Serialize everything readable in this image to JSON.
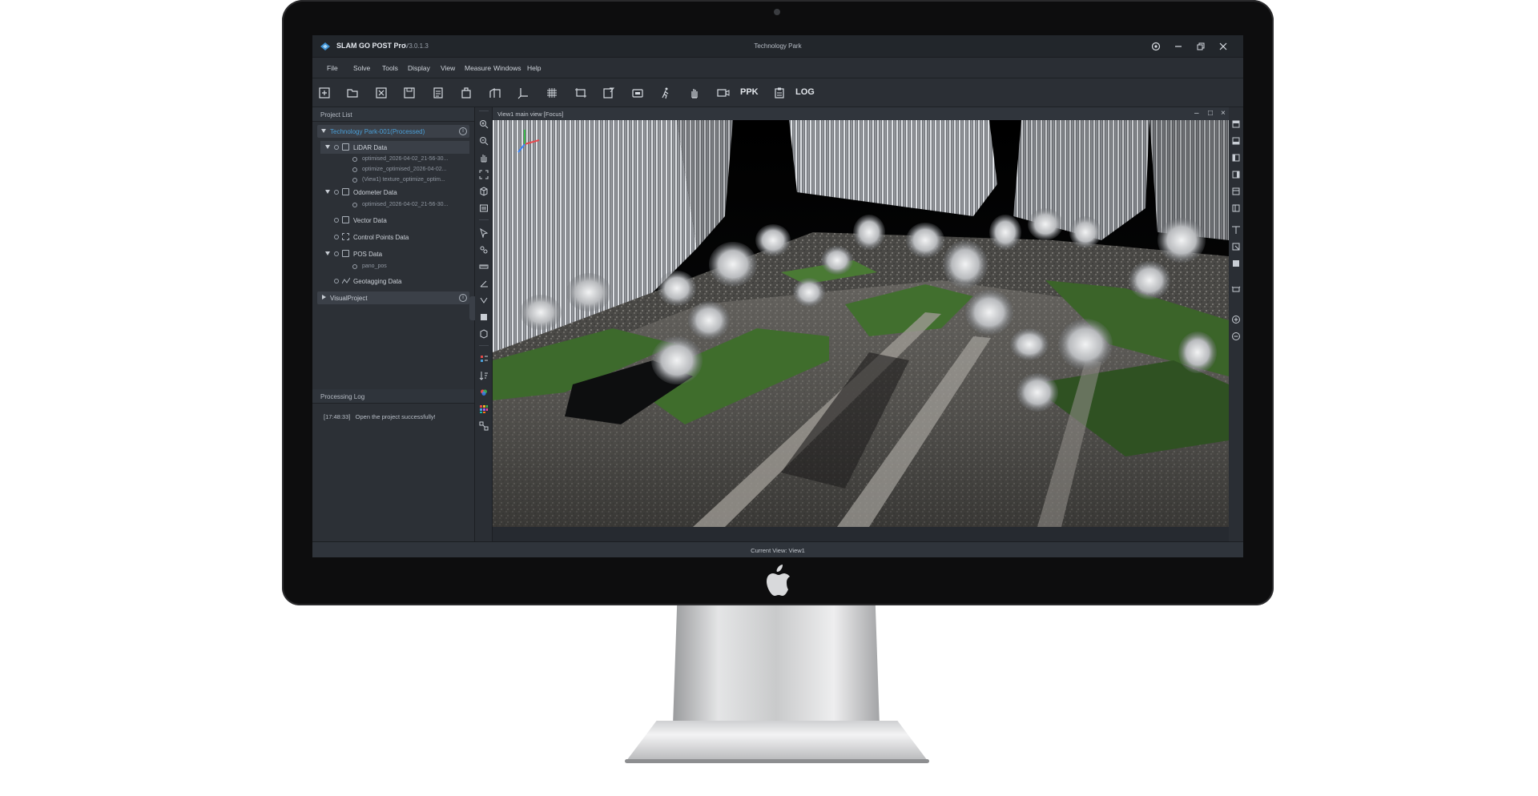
{
  "window": {
    "app_name": "SLAM GO POST Pro",
    "version": "V3.0.1.3",
    "title": "Technology Park"
  },
  "menu": [
    "File",
    "Solve",
    "Tools",
    "Display",
    "View",
    "Measure",
    "Windows",
    "Help"
  ],
  "toolbar": {
    "icons": [
      "new-project-icon",
      "open-project-icon",
      "close-project-icon",
      "save-icon",
      "import-icon",
      "export-icon",
      "building-icon",
      "axis-icon",
      "grid-icon",
      "crop-icon",
      "report-icon",
      "device-icon",
      "walk-icon",
      "hand-icon",
      "video-icon",
      "ppk-icon",
      "clipboard-icon",
      "log-icon"
    ],
    "ppk_label": "PPK",
    "log_label": "LOG"
  },
  "project_panel": {
    "title": "Project List",
    "project_name": "Technology Park-001(Processed)",
    "tree": {
      "lidar": "LiDAR Data",
      "lidar_children": [
        "optimised_2026-04-02_21-56-30...",
        "optimize_optimised_2026-04-02...",
        "(View1) texture_optimize_optim..."
      ],
      "odometer": "Odometer Data",
      "odometer_children": [
        "optimised_2026-04-02_21-56-30..."
      ],
      "vector": "Vector Data",
      "control": "Control Points Data",
      "pos": "POS Data",
      "pos_children": [
        "pano_pos"
      ],
      "geotag": "Geotagging Data"
    },
    "visual_project": "VisualProject"
  },
  "log_panel": {
    "title": "Processing Log",
    "entries": [
      {
        "time": "[17:48:33]",
        "message": "Open the project successfully!"
      }
    ]
  },
  "view": {
    "title": "View1 main view [Focus]"
  },
  "status": {
    "current_view": "Current View: View1"
  },
  "colors": {
    "bg": "#2b2f35",
    "titlebar": "#22262b",
    "accent": "#4a9fd8",
    "grass": "#3d6a2c"
  }
}
